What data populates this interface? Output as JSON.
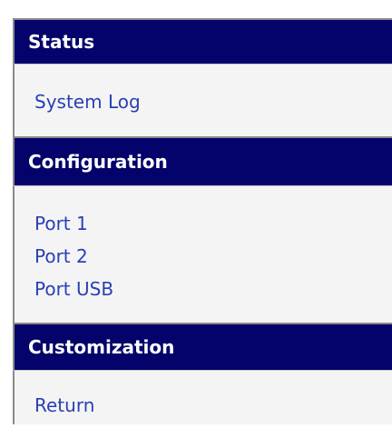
{
  "menu": {
    "status": {
      "title": "Status",
      "items": [
        {
          "label": "System Log"
        }
      ]
    },
    "configuration": {
      "title": "Configuration",
      "items": [
        {
          "label": "Port 1"
        },
        {
          "label": "Port 2"
        },
        {
          "label": "Port USB"
        }
      ]
    },
    "customization": {
      "title": "Customization",
      "items": [
        {
          "label": "Return"
        }
      ]
    }
  },
  "colors": {
    "header_bg": "#03036b",
    "header_text": "#ffffff",
    "body_bg": "#f4f4f4",
    "link": "#2a3fb5"
  }
}
